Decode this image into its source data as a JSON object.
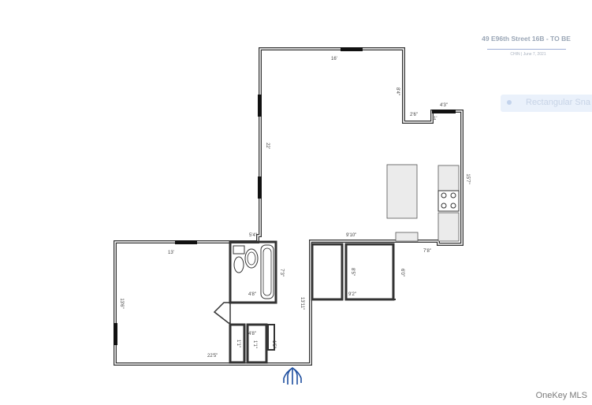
{
  "header": {
    "title": "49 E96th Street 16B - TO BE",
    "subtitle": "CHIN  |  June 7, 2021"
  },
  "tool_pill": {
    "label": "Rectangular Sna"
  },
  "watermark": "OneKey MLS",
  "dimensions": {
    "top_width": "16'",
    "upper_right_drop": "8'4\"",
    "step_in": "2'6\"",
    "step_small": "1'",
    "kitchen_top": "4'3\"",
    "kitchen_height": "15'7\"",
    "living_height": "22'",
    "hall_width": "5'4\"",
    "living_bottom": "9'10\"",
    "bath_height": "7'3\"",
    "bath_width": "4'8\"",
    "bedroom_top": "13'",
    "bedroom_height": "13'6\"",
    "bedroom_bottom": "22'5\"",
    "hall_height": "13'11\"",
    "closet_a_height": "8'5\"",
    "closet_a_width": "9'2\"",
    "closet_b_height": "6'0\"",
    "closet_b_width": "7'8\"",
    "small_closet_1": "1'1\"",
    "small_closet_2": "4'8\"",
    "small_closet_3": "1'1\"",
    "small_closet_4": "1'5\""
  },
  "colors": {
    "wall": "#333333",
    "window": "#111111",
    "fixture_fill": "#ebebeb",
    "entry_arrow": "#1f4f9f"
  }
}
